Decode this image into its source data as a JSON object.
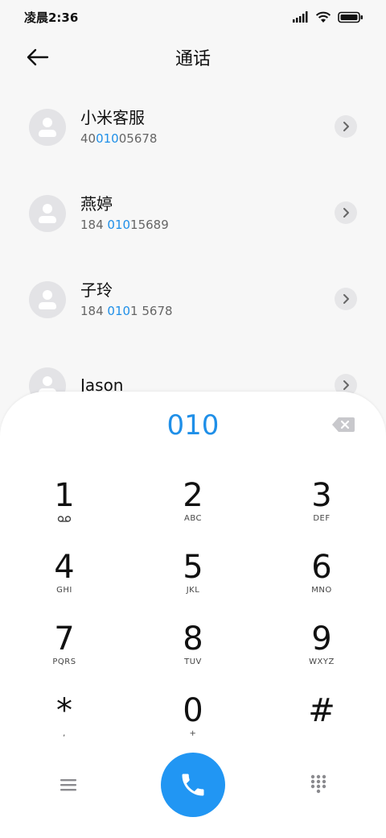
{
  "status_bar": {
    "time": "凌晨2:36",
    "icons": [
      "signal-icon",
      "wifi-icon",
      "battery-icon"
    ]
  },
  "header": {
    "title": "通话",
    "back_icon": "arrow-left-icon"
  },
  "contacts": [
    {
      "name": "小米客服",
      "number_pre": "40",
      "number_hl": "010",
      "number_post": "05678"
    },
    {
      "name": "燕婷",
      "number_pre": "184 ",
      "number_hl": "010",
      "number_post": "15689"
    },
    {
      "name": "子玲",
      "number_pre": "184 ",
      "number_hl": "010",
      "number_post": "1 5678"
    },
    {
      "name": "Jason",
      "number_pre": "",
      "number_hl": "",
      "number_post": ""
    }
  ],
  "dialpad": {
    "input": "010",
    "keys": [
      {
        "digit": "1",
        "letters": ""
      },
      {
        "digit": "2",
        "letters": "ABC"
      },
      {
        "digit": "3",
        "letters": "DEF"
      },
      {
        "digit": "4",
        "letters": "GHI"
      },
      {
        "digit": "5",
        "letters": "JKL"
      },
      {
        "digit": "6",
        "letters": "MNO"
      },
      {
        "digit": "7",
        "letters": "PQRS"
      },
      {
        "digit": "8",
        "letters": "TUV"
      },
      {
        "digit": "9",
        "letters": "WXYZ"
      },
      {
        "digit": "*",
        "letters": ","
      },
      {
        "digit": "0",
        "letters": "+"
      },
      {
        "digit": "#",
        "letters": ""
      }
    ]
  },
  "colors": {
    "accent": "#1f8fe8",
    "call_button": "#2196f3",
    "avatar_bg": "#e3e3e6"
  }
}
